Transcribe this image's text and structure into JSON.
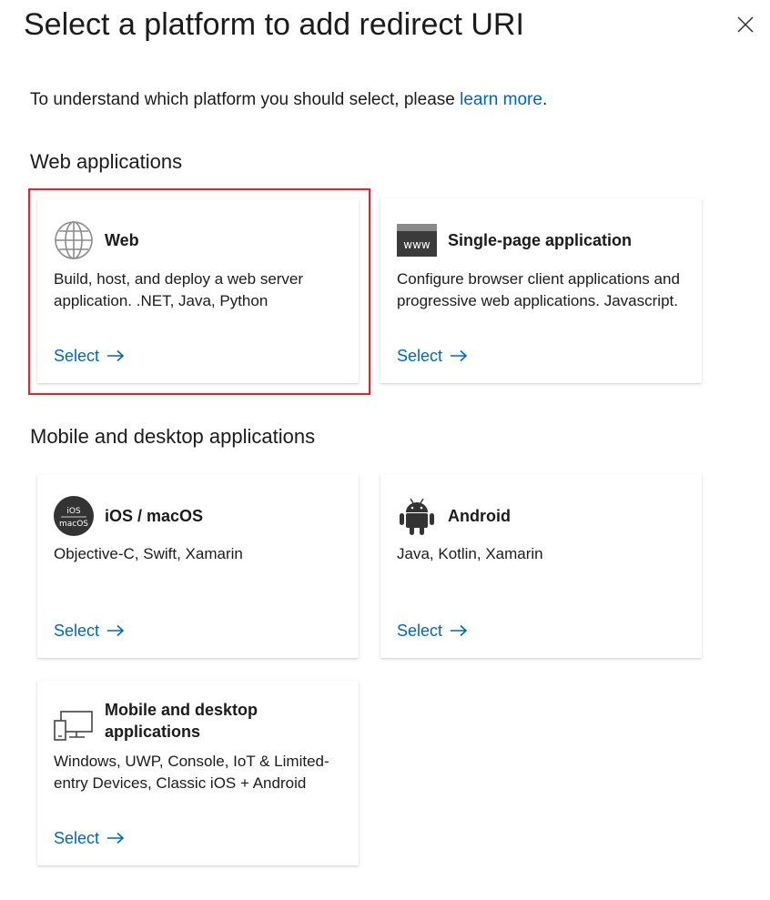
{
  "header": {
    "title": "Select a platform to add redirect URI",
    "close_icon": "close-icon"
  },
  "intro": {
    "text_before": "To understand which platform you should select, please ",
    "link_text": "learn more",
    "text_after": "."
  },
  "sections": {
    "web": {
      "heading": "Web applications"
    },
    "mobile": {
      "heading": "Mobile and desktop applications"
    }
  },
  "cards": {
    "web": {
      "title": "Web",
      "icon": "globe-icon",
      "description": "Build, host, and deploy a web server application. .NET, Java, Python",
      "select_label": "Select",
      "selected": true
    },
    "spa": {
      "title": "Single-page application",
      "icon": "www-browser-icon",
      "icon_text": "www",
      "description": "Configure browser client applications and progressive web applications. Javascript.",
      "select_label": "Select"
    },
    "ios": {
      "title": "iOS / macOS",
      "icon": "ios-macos-icon",
      "icon_text_top": "iOS",
      "icon_text_bottom": "macOS",
      "description": "Objective-C, Swift, Xamarin",
      "select_label": "Select"
    },
    "android": {
      "title": "Android",
      "icon": "android-icon",
      "description": "Java, Kotlin, Xamarin",
      "select_label": "Select"
    },
    "desktop": {
      "title": "Mobile and desktop applications",
      "icon": "desktop-mobile-icon",
      "description": "Windows, UWP, Console, IoT & Limited-entry Devices, Classic iOS + Android",
      "select_label": "Select"
    }
  },
  "colors": {
    "link": "#0067b8",
    "highlight": "#e0232e",
    "text": "#1b1b1b",
    "icon_dark": "#333333",
    "icon_gray": "#8a8a8a"
  }
}
